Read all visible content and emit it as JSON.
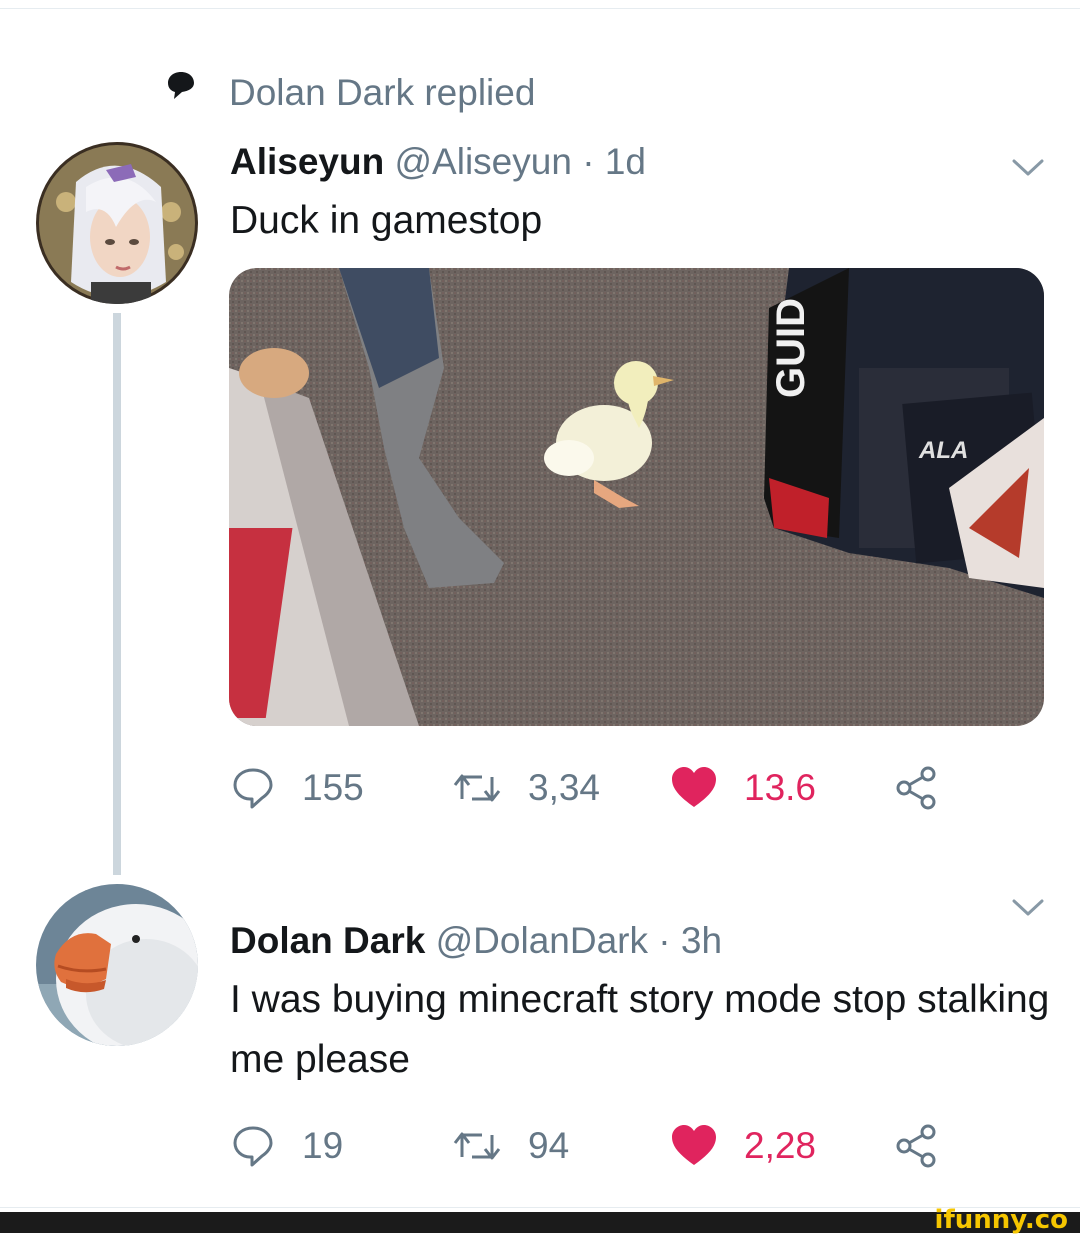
{
  "context": {
    "icon": "speech-bubble-icon",
    "text": "Dolan Dark replied"
  },
  "tweets": [
    {
      "display_name": "Aliseyun",
      "handle": "@Aliseyun",
      "separator": "·",
      "time": "1d",
      "text": "Duck in gamestop",
      "media": "photo of a white duckling walking on store carpet next to a person's leg and a game display",
      "actions": {
        "replies": "155",
        "retweets": "3,34",
        "likes": "13.6"
      }
    },
    {
      "display_name": "Dolan Dark",
      "handle": "@DolanDark",
      "separator": "·",
      "time": "3h",
      "text": "I was buying minecraft story mode stop stalking me please",
      "actions": {
        "replies": "19",
        "retweets": "94",
        "likes": "2,28"
      }
    }
  ],
  "icons": {
    "reply": "reply-icon",
    "retweet": "retweet-icon",
    "like": "heart-icon",
    "share": "share-icon",
    "more": "chevron-down-icon"
  },
  "colors": {
    "secondary_text": "#657786",
    "like": "#e0245e",
    "thread_line": "#ccd6dd"
  },
  "watermark": "ifunny.co"
}
